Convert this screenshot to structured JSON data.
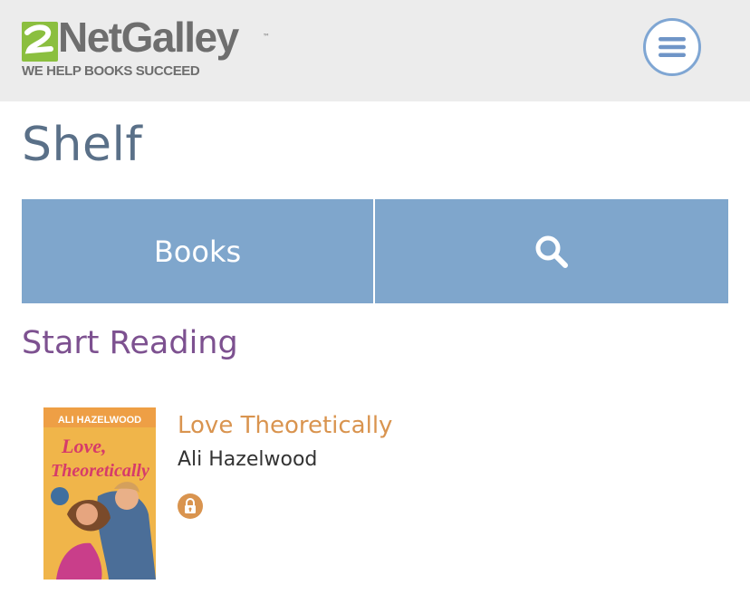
{
  "header": {
    "logo": {
      "name": "NetGalley",
      "trademark": "™",
      "tagline": "WE HELP BOOKS SUCCEED"
    },
    "menu_icon": "hamburger-menu-icon"
  },
  "page": {
    "title": "Shelf"
  },
  "tabs": [
    {
      "label": "Books"
    },
    {
      "icon": "search-icon"
    }
  ],
  "section": {
    "title": "Start Reading"
  },
  "books": [
    {
      "title": "Love Theoretically",
      "author": "Ali Hazelwood",
      "status_icon": "lock-icon",
      "cover": {
        "author_caps": "ALI HAZELWOOD",
        "title_line1": "Love,",
        "title_line2": "Theoretically"
      }
    }
  ],
  "colors": {
    "header_bg": "#ececec",
    "title": "#5a7088",
    "tab_bg": "#7fa6cc",
    "section_title": "#7d5190",
    "book_title": "#d9944f",
    "menu_ring": "#7fa6d3",
    "logo_green": "#8bbf3f"
  }
}
